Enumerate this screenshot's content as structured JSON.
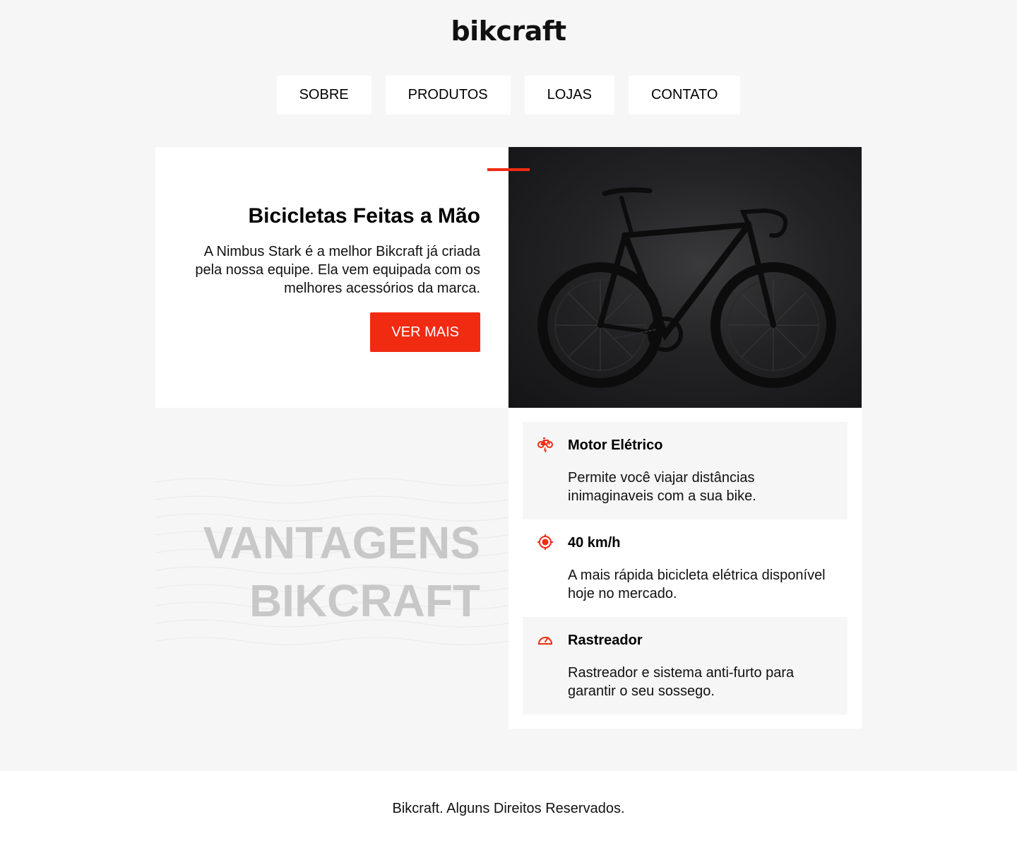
{
  "header": {
    "logo": "bikcraft",
    "nav": [
      "SOBRE",
      "PRODUTOS",
      "LOJAS",
      "CONTATO"
    ]
  },
  "hero": {
    "title": "Bicicletas Feitas a Mão",
    "description": "A Nimbus Stark é a melhor Bikcraft já criada pela nossa equipe. Ela vem equipada com os melhores acessórios da marca.",
    "button": "VER MAIS",
    "image": "black road bicycle on dark background"
  },
  "advantages": {
    "title_line1": "VANTAGENS",
    "title_line2": "BIKCRAFT",
    "items": [
      {
        "icon": "electric-bike-icon",
        "title": "Motor Elétrico",
        "text": "Permite você viajar distâncias inimaginaveis com a sua bike."
      },
      {
        "icon": "target-icon",
        "title": "40 km/h",
        "text": "A mais rápida bicicleta elétrica disponível hoje no mercado."
      },
      {
        "icon": "speedometer-icon",
        "title": "Rastreador",
        "text": "Rastreador e sistema anti-furto para garantir o seu sossego."
      }
    ]
  },
  "footer": {
    "text": "Bikcraft. Alguns Direitos Reservados."
  },
  "colors": {
    "accent": "#f12a12",
    "background": "#f6f6f6",
    "muted_title": "#c8c8c8"
  }
}
